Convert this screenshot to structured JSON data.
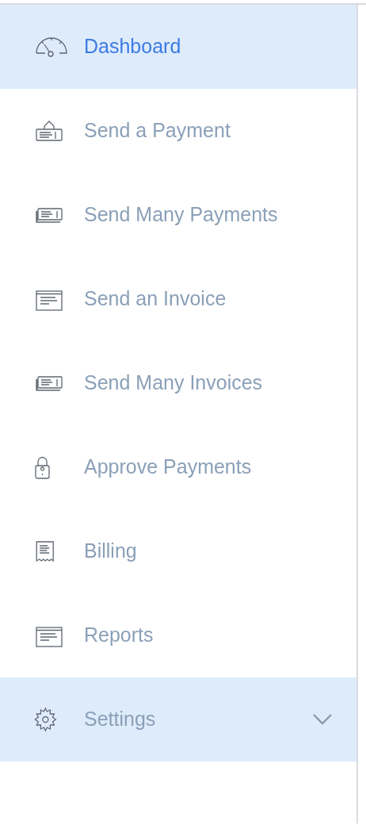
{
  "sidebar": {
    "items": [
      {
        "label": "Dashboard",
        "selected": true,
        "hovered": false
      },
      {
        "label": "Send a Payment",
        "selected": false,
        "hovered": false
      },
      {
        "label": "Send Many Payments",
        "selected": false,
        "hovered": false
      },
      {
        "label": "Send an Invoice",
        "selected": false,
        "hovered": false
      },
      {
        "label": "Send Many Invoices",
        "selected": false,
        "hovered": false
      },
      {
        "label": "Approve Payments",
        "selected": false,
        "hovered": false
      },
      {
        "label": "Billing",
        "selected": false,
        "hovered": false
      },
      {
        "label": "Reports",
        "selected": false,
        "hovered": false
      },
      {
        "label": "Settings",
        "selected": false,
        "hovered": true,
        "kind": "group",
        "expanded": false
      }
    ]
  }
}
